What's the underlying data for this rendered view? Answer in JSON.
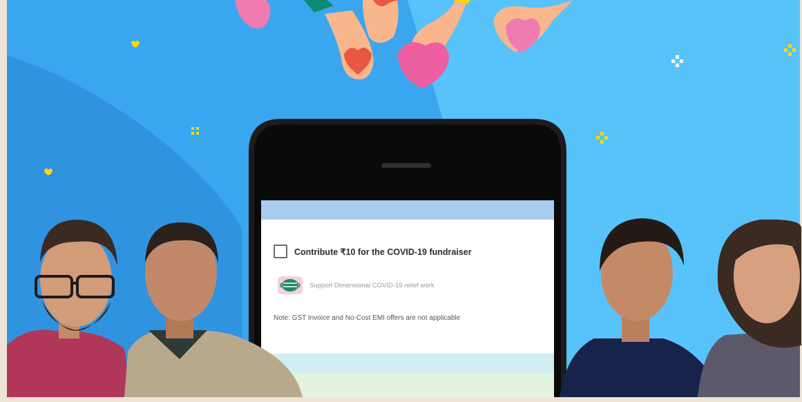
{
  "checkout": {
    "checkbox_label": "Contribute ₹10 for the COVID-19 fundraiser",
    "support_text": "Support Dimensional COVID-19 relief work",
    "note": "Note: GST Invoice and No-Cost EMI offers are not applicable"
  },
  "icons": [
    "heart-icon",
    "sparkle-icon",
    "face-mask-icon"
  ],
  "colors": {
    "sky": "#3aa6f0",
    "sky_light": "#5ec8fb",
    "heart_pink": "#ee5fa0",
    "heart_red": "#e8573f",
    "accent_yellow": "#ffd800"
  }
}
